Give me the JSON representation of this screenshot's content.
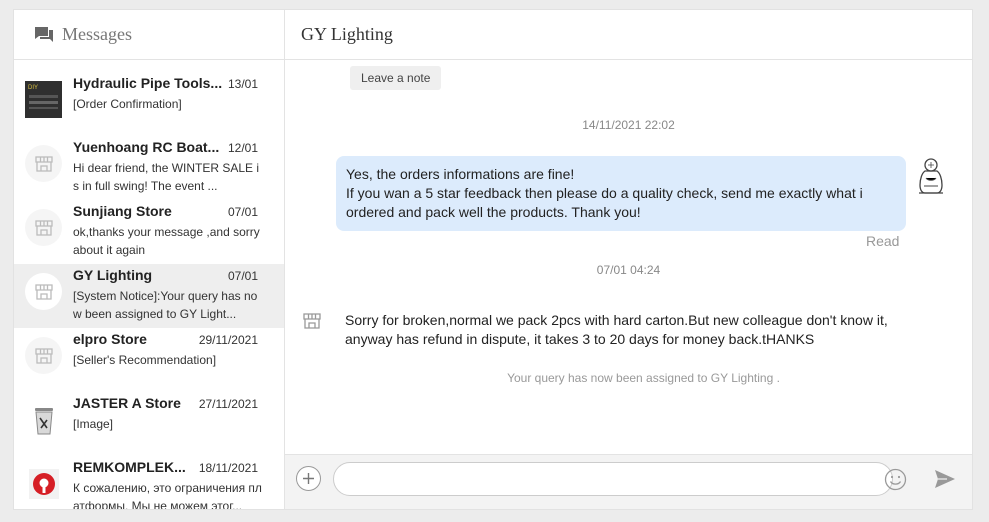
{
  "sidebar": {
    "title": "Messages",
    "conversations": [
      {
        "name": "Hydraulic Pipe Tools...",
        "date": "13/01",
        "preview": "[Order Confirmation]",
        "avatar": "product-image"
      },
      {
        "name": "Yuenhoang RC Boat...",
        "date": "12/01",
        "preview": "Hi dear friend, the WINTER SALE is in full swing! The event ...",
        "avatar": "store-icon"
      },
      {
        "name": "Sunjiang Store",
        "date": "07/01",
        "preview": "ok,thanks your message ,and sorry about it again",
        "avatar": "store-icon"
      },
      {
        "name": "GY Lighting",
        "date": "07/01",
        "preview": "[System Notice]:Your query has now been assigned to GY Light...",
        "avatar": "store-icon",
        "active": true
      },
      {
        "name": "elpro Store",
        "date": "29/11/2021",
        "preview": "[Seller's Recommendation]",
        "avatar": "store-icon"
      },
      {
        "name": "JASTER A Store",
        "date": "27/11/2021",
        "preview": "[Image]",
        "avatar": "trash-bin-logo"
      },
      {
        "name": "REMKOMPLEK...",
        "date": "18/11/2021",
        "preview": "К сожалению, это ограничения платформы. Мы не можем этог...",
        "avatar": "red-circle-logo"
      }
    ]
  },
  "chat": {
    "title": "GY Lighting",
    "leave_note": "Leave a note",
    "timestamp1": "14/11/2021 22:02",
    "outgoing_line1": "Yes, the orders informations are fine!",
    "outgoing_line2": "If you wan a 5 star feedback then please do a quality check, send me exactly what i ordered and pack well the products. Thank you!",
    "read_status": "Read",
    "timestamp2": "07/01 04:24",
    "incoming": "Sorry for broken,normal we pack 2pcs with hard carton.But new colleague don't know it, anyway has refund in dispute, it takes 3 to 20 days for money back.tHANKS",
    "system_notice": "Your query has now been assigned to GY Lighting ."
  },
  "input": {
    "placeholder": ""
  }
}
